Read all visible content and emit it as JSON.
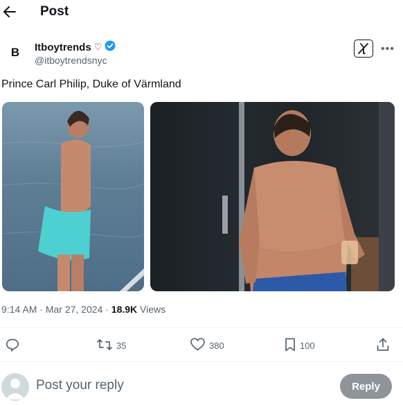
{
  "header": {
    "title": "Post"
  },
  "author": {
    "name": "Itboytrends",
    "name_suffix": "♡",
    "handle": "@itboytrendsnyc",
    "avatar_letter": "B"
  },
  "post": {
    "text": "Prince Carl Philip, Duke of Värmland",
    "time": "9:14 AM",
    "sep1": "·",
    "date": "Mar 27, 2024",
    "sep2": "·",
    "views_count": "18.9K",
    "views_label": "Views"
  },
  "actions": {
    "retweets": "35",
    "likes": "380",
    "bookmarks": "100"
  },
  "reply": {
    "placeholder": "Post your reply",
    "button": "Reply"
  },
  "colors": {
    "verified": "#1d9bf0",
    "reply_button": "#8e9499",
    "muted_text": "#536471"
  }
}
